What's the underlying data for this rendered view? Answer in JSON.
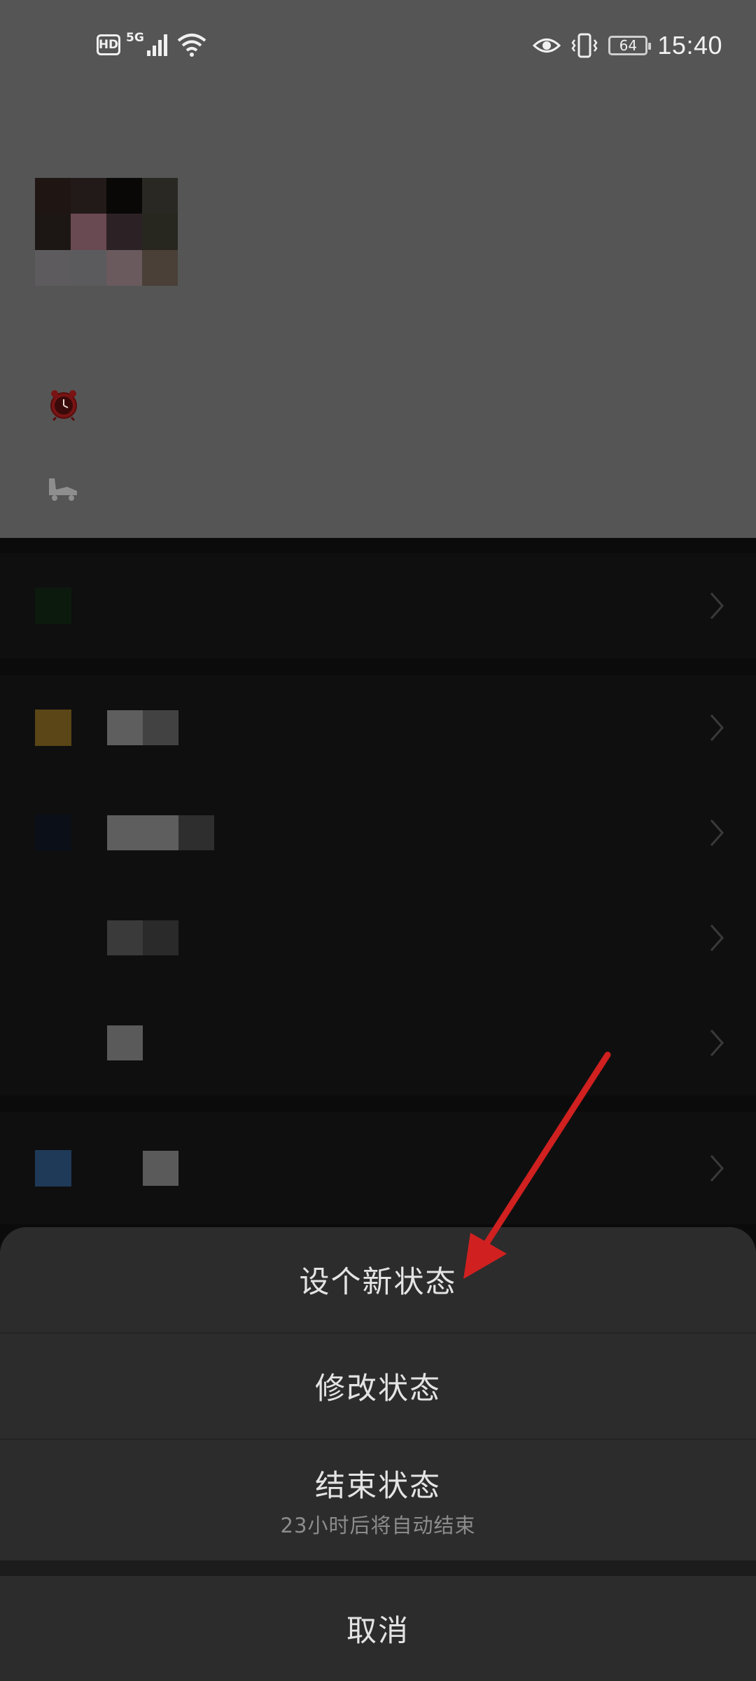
{
  "status_bar": {
    "hd": "HD",
    "network": "5G",
    "battery": "64",
    "time": "15:40"
  },
  "icons": {
    "alarm": "alarm-clock-icon",
    "skate": "roller-skate-icon",
    "chevron": "chevron-right-icon"
  },
  "action_sheet": {
    "items": [
      {
        "label": "设个新状态"
      },
      {
        "label": "修改状态"
      },
      {
        "label": "结束状态",
        "sublabel": "23小时后将自动结束"
      }
    ],
    "cancel_label": "取消"
  },
  "colors": {
    "header_bg": "#555555",
    "list_bg": "#0f0f0f",
    "sheet_item_bg": "#2c2c2c",
    "annotation_arrow": "#d02020"
  }
}
